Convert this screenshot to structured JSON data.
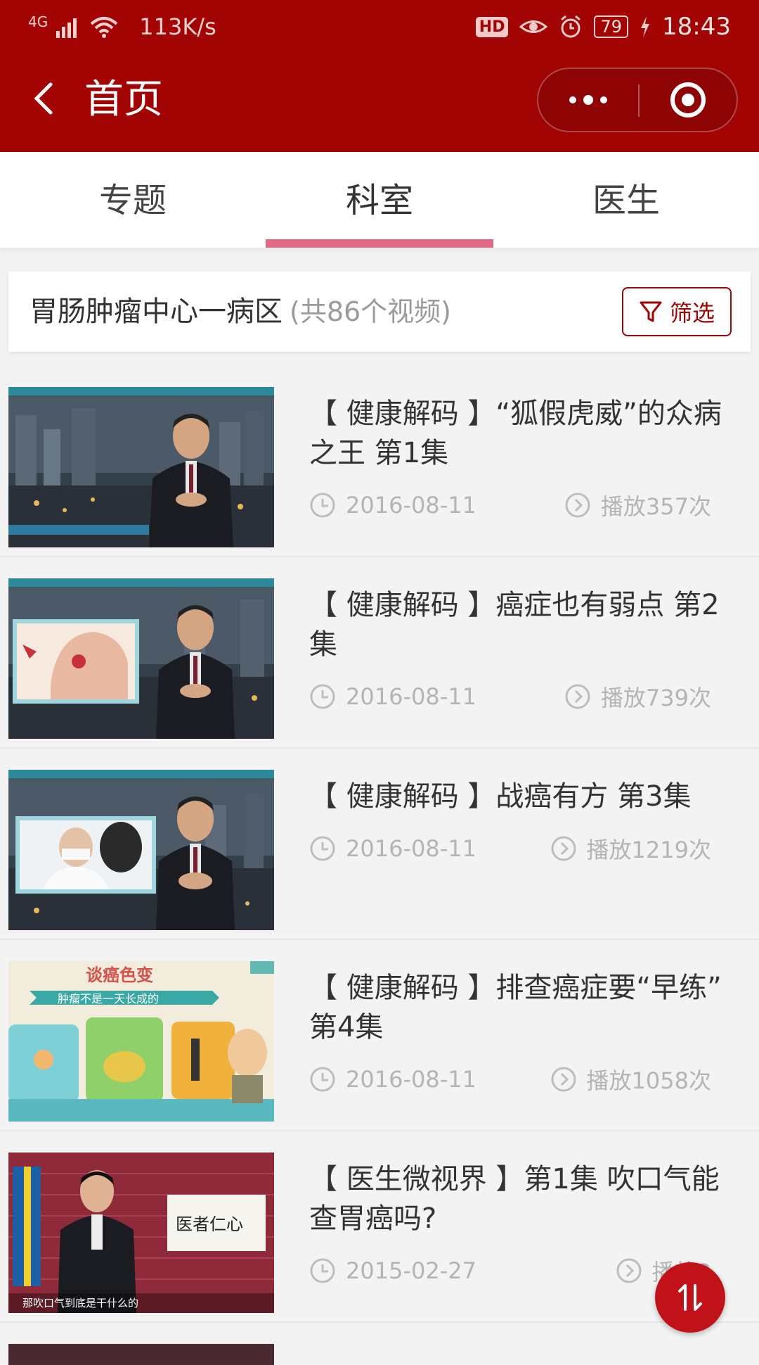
{
  "status_bar": {
    "network": "4G",
    "speed": "113K/s",
    "hd": "HD",
    "battery": "79",
    "time": "18:43"
  },
  "nav": {
    "title": "首页"
  },
  "tabs": [
    {
      "label": "专题",
      "active": false
    },
    {
      "label": "科室",
      "active": true
    },
    {
      "label": "医生",
      "active": false
    }
  ],
  "department": {
    "name": "胃肠肿瘤中心一病区",
    "count_text": "(共86个视频)",
    "filter_label": "筛选"
  },
  "videos": [
    {
      "title": "【 健康解码 】“狐假虎威”的众病之王 第1集",
      "date": "2016-08-11",
      "plays": "播放357次"
    },
    {
      "title": "【 健康解码 】癌症也有弱点 第2集",
      "date": "2016-08-11",
      "plays": "播放739次"
    },
    {
      "title": "【 健康解码 】战癌有方 第3集",
      "date": "2016-08-11",
      "plays": "播放1219次"
    },
    {
      "title": "【 健康解码 】排查癌症要“早练” 第4集",
      "date": "2016-08-11",
      "plays": "播放1058次"
    },
    {
      "title": "【 医生微视界 】第1集 吹口气能查胃癌吗?",
      "date": "2015-02-27",
      "plays": "播放3"
    }
  ],
  "thumb_texts": {
    "thumb4_title": "谈癌色变",
    "thumb4_banner": "肿瘤不是一天长成的",
    "thumb5_plaque": "医者仁心",
    "thumb5_caption": "那吹口气到底是干什么的"
  },
  "colors": {
    "header": "#a20404",
    "tab_indicator": "#e06a86",
    "fab": "#c1121a"
  }
}
